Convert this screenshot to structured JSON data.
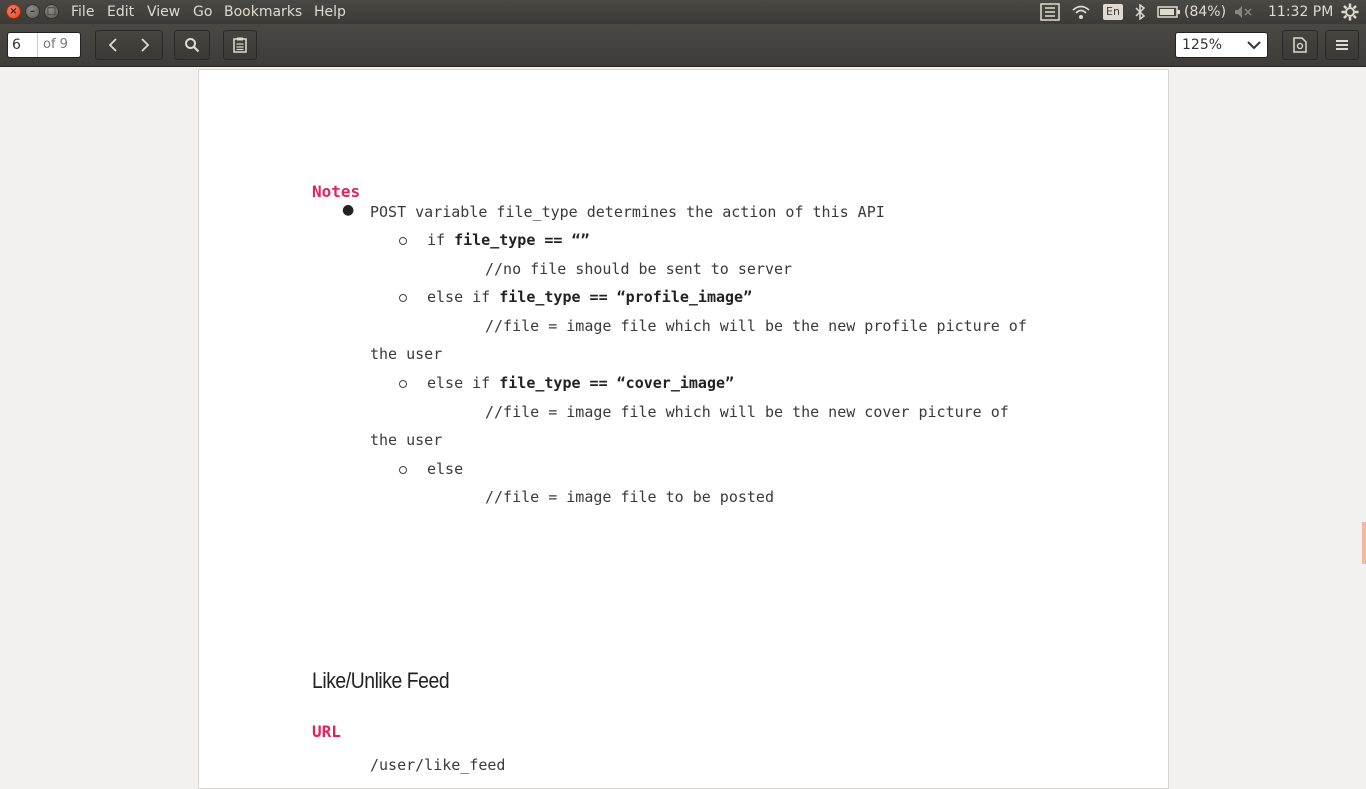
{
  "menubar": {
    "menus": [
      "File",
      "Edit",
      "View",
      "Go",
      "Bookmarks",
      "Help"
    ],
    "keyboard_layout": "En",
    "battery": "(84%)",
    "clock": "11:32 PM"
  },
  "toolbar": {
    "page_current": "6",
    "page_total": "of 9",
    "zoom": "125%"
  },
  "document": {
    "notes_heading": "Notes",
    "bullet_text": "POST variable file_type determines the action of this API",
    "if1_prefix": "if ",
    "if1_cond": "file_type == “”",
    "if1_comment": "//no file should be sent to server",
    "if2_prefix": "else if ",
    "if2_cond": "file_type == “profile_image”",
    "if2_comment": "//file = image file which will be the new profile picture of",
    "if2_cont": "the user",
    "if3_prefix": "else if ",
    "if3_cond": "file_type == “cover_image”",
    "if3_comment": "//file = image file which will be the new cover picture of",
    "if3_cont": "the user",
    "else_text": "else",
    "else_comment": "//file = image file to be posted",
    "section_title": "Like/Unlike Feed",
    "url_heading": "URL",
    "url_value": "/user/like_feed"
  }
}
